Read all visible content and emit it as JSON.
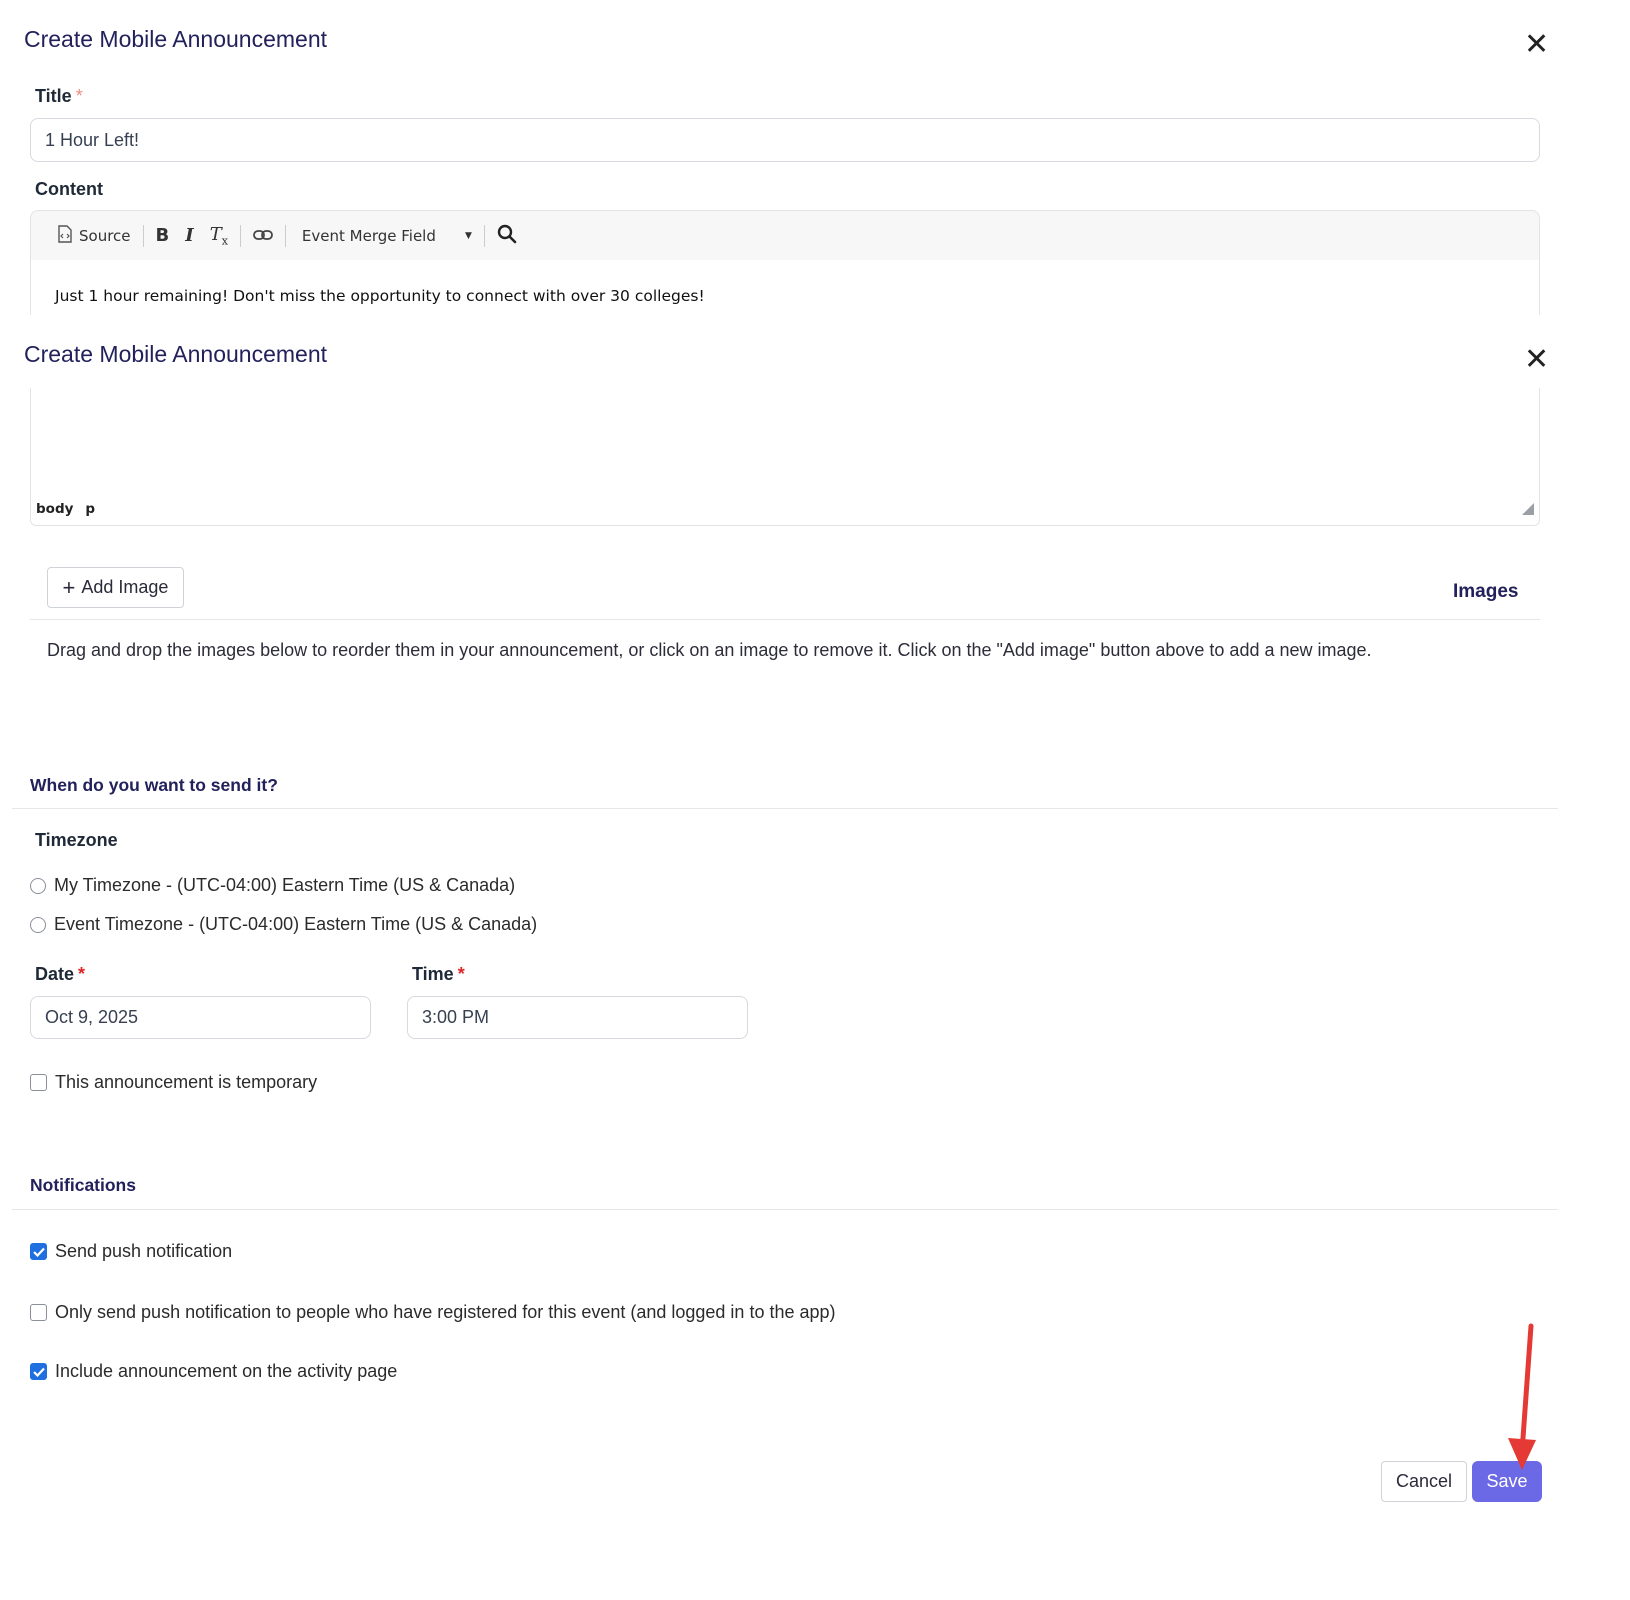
{
  "dialog": {
    "title": "Create Mobile Announcement",
    "close_label": "✕"
  },
  "form": {
    "title_label": "Title",
    "title_value": "1 Hour Left!",
    "content_label": "Content",
    "editor": {
      "toolbar": {
        "source_label": "Source",
        "bold_label": "B",
        "italic_label": "I",
        "clear_format_label": "T",
        "merge_field_label": "Event Merge Field"
      },
      "content_text": "Just 1 hour remaining! Don't miss the opportunity to connect with over 30 colleges!",
      "path": [
        "body",
        "p"
      ]
    },
    "images": {
      "add_button_label": "Add Image",
      "heading": "Images",
      "instructions": "Drag and drop the images below to reorder them in your announcement, or click on an image to remove it. Click on the \"Add image\" button above to add a new image."
    }
  },
  "schedule": {
    "section_title": "When do you want to send it?",
    "timezone_label": "Timezone",
    "timezone_options": [
      {
        "label": "My Timezone - (UTC-04:00) Eastern Time (US & Canada)",
        "selected": false
      },
      {
        "label": "Event Timezone - (UTC-04:00) Eastern Time (US & Canada)",
        "selected": false
      }
    ],
    "date_label": "Date",
    "date_value": "Oct 9, 2025",
    "time_label": "Time",
    "time_value": "3:00 PM",
    "temporary_label": "This announcement is temporary",
    "temporary_checked": false
  },
  "notifications": {
    "section_title": "Notifications",
    "options": [
      {
        "label": "Send push notification",
        "checked": true
      },
      {
        "label": "Only send push notification to people who have registered for this event (and logged in to the app)",
        "checked": false
      },
      {
        "label": "Include announcement on the activity page",
        "checked": true
      }
    ]
  },
  "footer": {
    "cancel_label": "Cancel",
    "save_label": "Save"
  },
  "colors": {
    "primary": "#6c69e6",
    "title": "#22215b",
    "checkbox": "#1f6fe0",
    "annotation_arrow": "#e53935"
  }
}
